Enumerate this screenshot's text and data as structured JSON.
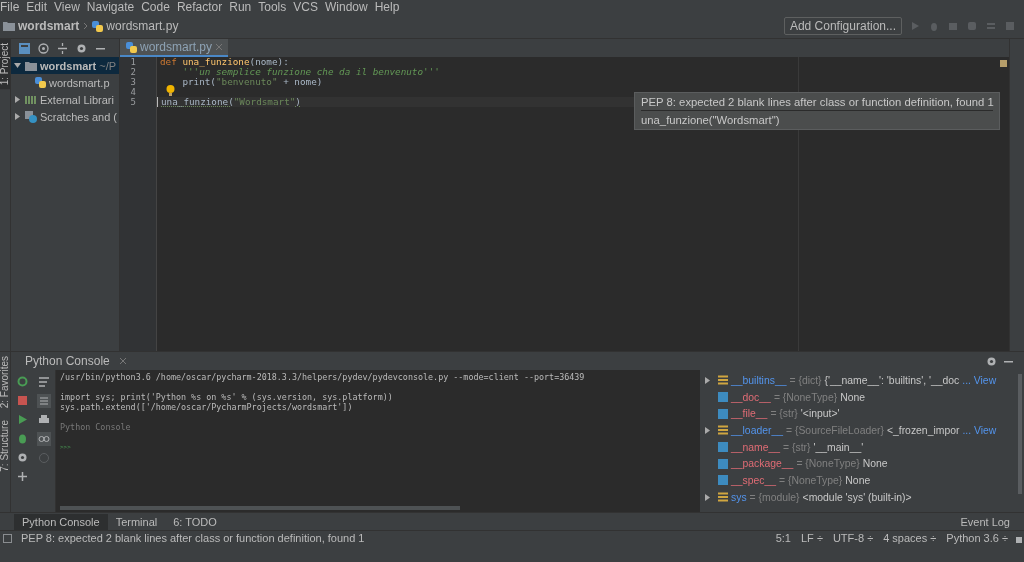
{
  "menu": [
    "File",
    "Edit",
    "View",
    "Navigate",
    "Code",
    "Refactor",
    "Run",
    "Tools",
    "VCS",
    "Window",
    "Help"
  ],
  "breadcrumb": {
    "project": "wordsmart",
    "file": "wordsmart.py"
  },
  "toolbar": {
    "config_button": "Add Configuration..."
  },
  "left_strip": {
    "top": "1: Project",
    "bottom_favorites": "2: Favorites",
    "bottom_structure": "7: Structure"
  },
  "project_tree": [
    {
      "name": "wordsmart",
      "path": "~/P",
      "kind": "folder",
      "expanded": true,
      "selected": true,
      "children": [
        {
          "name": "wordsmart.p",
          "kind": "python",
          "selected": false
        }
      ]
    },
    {
      "name": "External Librari",
      "kind": "library",
      "expanded": false,
      "selected": false
    },
    {
      "name": "Scratches and (",
      "kind": "scratch",
      "expanded": false,
      "selected": false
    }
  ],
  "editor_tabs": [
    {
      "label": "wordsmart.py",
      "selected": true
    }
  ],
  "code": [
    {
      "number": "1",
      "tokens": [
        {
          "kind": "keyword",
          "text": "def "
        },
        {
          "kind": "func",
          "text": "una_funzione"
        },
        {
          "kind": "plain",
          "text": "(nome):"
        }
      ]
    },
    {
      "number": "2",
      "tokens": [
        {
          "kind": "doc",
          "text": "    '''un semplice funzione che da il benvenuto'''"
        }
      ]
    },
    {
      "number": "3",
      "tokens": [
        {
          "kind": "plain",
          "text": "    print("
        },
        {
          "kind": "string",
          "text": "\"benvenuto\""
        },
        {
          "kind": "plain",
          "text": " + nome)"
        }
      ]
    },
    {
      "number": "4"
    },
    {
      "number": "5",
      "current": true,
      "tokens": [
        {
          "kind": "call",
          "text": "una_funzione("
        },
        {
          "kind": "string",
          "text": "\"Wordsmart\""
        },
        {
          "kind": "call",
          "text": ")"
        }
      ]
    }
  ],
  "tooltip": {
    "message": "PEP 8: expected 2 blank lines after class or function definition, found 1",
    "code": "una_funzione(\"Wordsmart\")"
  },
  "console": {
    "title": "Python Console",
    "lines": [
      {
        "kind": "command",
        "text": "/usr/bin/python3.6 /home/oscar/pycharm-2018.3.3/helpers/pydev/pydevconsole.py --mode=client --port=36439"
      },
      {
        "kind": "blank"
      },
      {
        "kind": "command",
        "text": "import sys; print('Python %s on %s' % (sys.version, sys.platform))"
      },
      {
        "kind": "command",
        "text": "sys.path.extend(['/home/oscar/PycharmProjects/wordsmart'])"
      },
      {
        "kind": "blank"
      },
      {
        "kind": "info",
        "text": "Python Console"
      },
      {
        "kind": "blank"
      },
      {
        "kind": "prompt",
        "text": ">>>"
      }
    ]
  },
  "variables": [
    {
      "kind": "group",
      "name": "__builtins__",
      "type": "= {dict}",
      "value": "{'__name__': 'builtins', '__doc",
      "link": "... View"
    },
    {
      "kind": "attr",
      "name": "__doc__",
      "type": "= {NoneType}",
      "value": "None"
    },
    {
      "kind": "attr",
      "name": "__file__",
      "type": "= {str}",
      "value": "'<input>'"
    },
    {
      "kind": "group",
      "name": "__loader__",
      "type": "= {SourceFileLoader}",
      "value": "<_frozen_impor",
      "link": "... View"
    },
    {
      "kind": "attr",
      "name": "__name__",
      "type": "= {str}",
      "value": "'__main__'"
    },
    {
      "kind": "attr",
      "name": "__package__",
      "type": "= {NoneType}",
      "value": "None"
    },
    {
      "kind": "attr",
      "name": "__spec__",
      "type": "= {NoneType}",
      "value": "None"
    },
    {
      "kind": "group",
      "name": "sys",
      "type": "= {module}",
      "value": "<module 'sys' (built-in)>"
    }
  ],
  "bottom_tabs": [
    {
      "label": "Python Console",
      "selected": true
    },
    {
      "label": "Terminal",
      "selected": false
    },
    {
      "label": "6: TODO",
      "selected": false
    }
  ],
  "event_log": "Event Log",
  "status_bar": {
    "message": "PEP 8: expected 2 blank lines after class or function definition, found 1",
    "position": "5:1",
    "line_sep": "LF ÷",
    "encoding": "UTF-8 ÷",
    "indent": "4 spaces ÷",
    "interpreter": "Python 3.6 ÷"
  }
}
